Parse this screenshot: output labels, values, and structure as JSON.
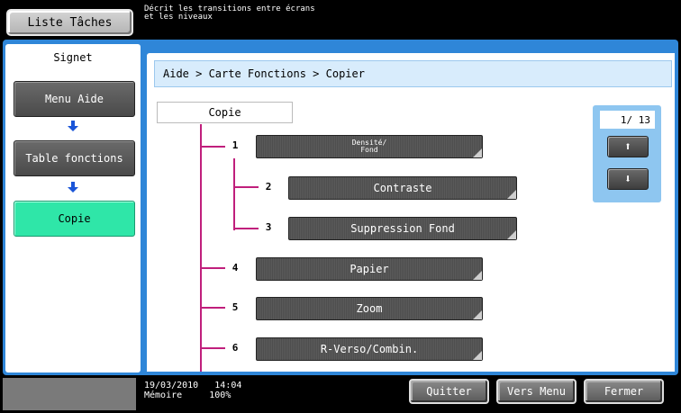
{
  "topbar": {
    "task_list_label": "Liste Tâches",
    "description_line1": "Décrit les transitions entre écrans",
    "description_line2": "et les niveaux"
  },
  "sidebar": {
    "title": "Signet",
    "items": [
      {
        "label": "Menu Aide"
      },
      {
        "label": "Table fonctions"
      },
      {
        "label": "Copie"
      }
    ]
  },
  "main": {
    "breadcrumb": "Aide > Carte Fonctions > Copier",
    "root_label": "Copie",
    "functions": [
      {
        "num": "1",
        "label_line1": "Densité/",
        "label_line2": "Fond"
      },
      {
        "num": "2",
        "label": "Contraste"
      },
      {
        "num": "3",
        "label": "Suppression Fond"
      },
      {
        "num": "4",
        "label": "Papier"
      },
      {
        "num": "5",
        "label": "Zoom"
      },
      {
        "num": "6",
        "label": "R-Verso/Combin."
      }
    ]
  },
  "pager": {
    "page": "1/ 13",
    "up_glyph": "⬆",
    "down_glyph": "⬇"
  },
  "footer": {
    "date": "19/03/2010",
    "time": "14:04",
    "memory_label": "Mémoire",
    "memory_value": "100%",
    "quit_label": "Quitter",
    "menu_label": "Vers Menu",
    "close_label": "Fermer"
  },
  "colors": {
    "frame_blue": "#2f86d8",
    "active_green": "#2fe6a8",
    "tree_line": "#c01f7c",
    "arrow_blue": "#1a55d8"
  }
}
